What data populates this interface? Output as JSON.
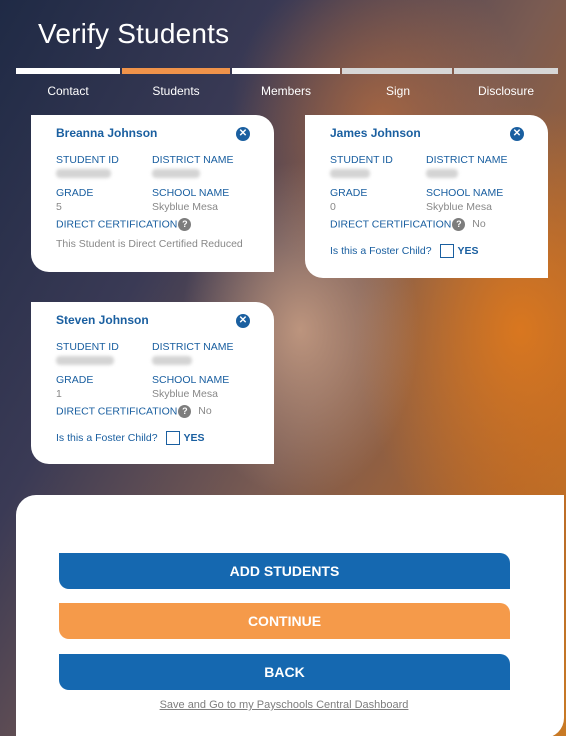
{
  "page": {
    "title": "Verify Students"
  },
  "steps": [
    {
      "label": "Contact",
      "color": "#ffffff"
    },
    {
      "label": "Students",
      "color": "#f0934a"
    },
    {
      "label": "Members",
      "color": "#ffffff"
    },
    {
      "label": "Sign",
      "color": "#d7d7d7"
    },
    {
      "label": "Disclosure",
      "color": "#d7d7d7"
    }
  ],
  "labels": {
    "student_id": "STUDENT ID",
    "district_name": "DISTRICT NAME",
    "grade": "GRADE",
    "school_name": "SCHOOL NAME",
    "direct_certification": "DIRECT CERTIFICATION",
    "foster_question": "Is this a Foster Child?",
    "yes": "YES"
  },
  "students": [
    {
      "name": "Breanna Johnson",
      "grade": "5",
      "school": "Skyblue Mesa",
      "direct_cert": "This Student is Direct Certified Reduced"
    },
    {
      "name": "James Johnson",
      "grade": "0",
      "school": "Skyblue Mesa",
      "direct_cert": "No"
    },
    {
      "name": "Steven Johnson",
      "grade": "1",
      "school": "Skyblue Mesa",
      "direct_cert": "No"
    }
  ],
  "actions": {
    "add": "ADD STUDENTS",
    "continue": "CONTINUE",
    "back": "BACK",
    "dashboard_link": "Save and Go to my Payschools Central Dashboard"
  },
  "colors": {
    "primary": "#1568b0",
    "accent": "#f59a4a",
    "label": "#1a5fa0"
  },
  "icons": {
    "close": "close-circle-icon",
    "help": "question-circle-icon",
    "checkbox": "checkbox-empty"
  }
}
